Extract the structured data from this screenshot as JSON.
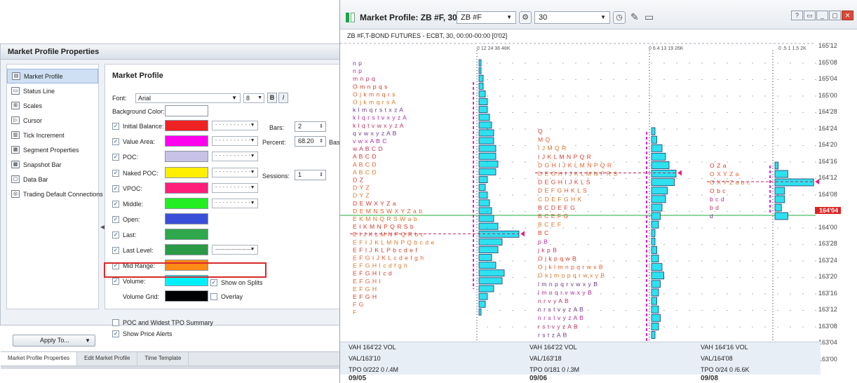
{
  "props": {
    "title": "Market Profile Properties",
    "sidebar": [
      {
        "label": "Market Profile",
        "icon": "market-profile-icon",
        "glyph": "▤"
      },
      {
        "label": "Status Line",
        "icon": "status-line-icon",
        "glyph": "▭"
      },
      {
        "label": "Scales",
        "icon": "scales-icon",
        "glyph": "⊞"
      },
      {
        "label": "Cursor",
        "icon": "cursor-icon",
        "glyph": "▷"
      },
      {
        "label": "Tick Increment",
        "icon": "tick-increment-icon",
        "glyph": "▥"
      },
      {
        "label": "Segment Properties",
        "icon": "segment-properties-icon",
        "glyph": "▦"
      },
      {
        "label": "Snapshot Bar",
        "icon": "snapshot-bar-icon",
        "glyph": "▩"
      },
      {
        "label": "Data Bar",
        "icon": "data-bar-icon",
        "glyph": "▢"
      },
      {
        "label": "Trading Default Connections",
        "icon": "connections-icon",
        "glyph": "◎"
      }
    ],
    "apply_label": "Apply To...",
    "heading": "Market Profile",
    "font_label": "Font:",
    "font_value": "Arial",
    "font_size": "8",
    "bold_label": "B",
    "italic_label": "I",
    "bg_label": "Background Color:",
    "rows": [
      {
        "label": "Initial Balance:",
        "color": "#ee2222",
        "line": "- - - - - - - - - -"
      },
      {
        "label": "Value Area:",
        "color": "#ff00ee",
        "line": "- - - - - - - - - -"
      },
      {
        "label": "POC:",
        "color": "#c8c2e6",
        "line": "- - - - - - - - - -"
      },
      {
        "label": "Naked POC:",
        "color": "#ffee00",
        "line": "- - - - - - - - - -"
      },
      {
        "label": "VPOC:",
        "color": "#ff1f7a",
        "line": "- - - - - - - - - -"
      },
      {
        "label": "Middle:",
        "color": "#22ee22",
        "line": "- - - - - - - - - -"
      },
      {
        "label": "Open:",
        "color": "#3a4fd8"
      },
      {
        "label": "Last:",
        "color": "#2ea84a"
      },
      {
        "label": "Last Level:",
        "color": "#2a9a45",
        "line": "———————"
      },
      {
        "label": "Mid Range:",
        "color": "#ff8a14"
      },
      {
        "label": "Volume:",
        "color": "#00f0ff"
      },
      {
        "label": "Volume Grid:",
        "color": "#000000"
      }
    ],
    "bars_label": "Bars:",
    "bars_value": "2",
    "percent_label": "Percent:",
    "percent_value": "68.20",
    "percent_suffix": "Bas",
    "sessions_label": "Sessions:",
    "sessions_value": "1",
    "show_on_splits": "Show on Splits",
    "overlay": "Overlay",
    "poc_widest": "POC and Widest TPO Summary",
    "price_alerts": "Show Price Alerts",
    "tabs": [
      "Market Profile Properties",
      "Edit Market Profile",
      "Time Template"
    ]
  },
  "chart": {
    "title": "Market Profile: ZB #F, 30",
    "symbol": "ZB #F",
    "interval": "30",
    "info_line": "ZB #F,T-BOND FUTURES - ECBT, 30, 00:00-00:00  [0'02]",
    "window_buttons": [
      "?",
      "▭",
      "_",
      "▢",
      "✕"
    ],
    "volume_scales": [
      {
        "label": "0  12  24  36  48K"
      },
      {
        "label": "0  6.4  13  19  26K"
      },
      {
        "label": "0  .5  1  1.5  2K"
      }
    ],
    "price_axis": [
      "165'12",
      "165'08",
      "165'04",
      "165'00",
      "164'28",
      "164'24",
      "164'20",
      "164'16",
      "164'12",
      "164'08",
      "164'04",
      "164'00",
      "163'28",
      "163'24",
      "163'20",
      "163'16",
      "163'12",
      "163'08",
      "163'04",
      "163'00"
    ],
    "current_price": "164'04",
    "summaries": [
      {
        "vah": "VAH 164'22  VOL",
        "val": "VAL/163'10",
        "tpo": "TPO 0/222  0 /.4M",
        "date": "09/05"
      },
      {
        "vah": "VAH 164'22  VOL",
        "val": "VAL/163'18",
        "tpo": "TPO 0/181    0 /.3M",
        "date": "09/06"
      },
      {
        "vah": "VAH 164'16  VOL",
        "val": "VAL/164'08",
        "tpo": "TPO 0/24    0 /6.6K",
        "date": "09/08"
      }
    ],
    "profiles": [
      {
        "rows": [
          "n p",
          "n p",
          "m n p q",
          "O m n p q s",
          "O j k m n q r s",
          "O j k m q r s A",
          "k l m q r s t x z A",
          "k l q r s t v x y z A",
          "k l q t v w x y z A",
          "q v w x y z A B",
          "v w x A B C",
          "w A B C D",
          "A B C D",
          "A B C D",
          "A B C D",
          "D Z",
          "D Y Z",
          "D Y Z",
          "D E W X Y Z a",
          "D E M N S W X Y Z a b",
          "E K M N Q R S W a b",
          "E I K M N P Q R S b",
          "E I J K L M N P Q R b c",
          "E F I J K L M N P Q b c d e",
          "E F I J K L P b c d e f",
          "E F G I J K L c d e f g h",
          "E F G H I c d f g h",
          "E F G H I c d",
          "E F G H I",
          "E F G H",
          "E F G H",
          "F G",
          "F"
        ],
        "volumes": [
          1,
          1,
          2,
          2,
          3,
          4,
          4,
          5,
          6,
          7,
          7,
          8,
          8,
          9,
          8,
          4,
          3,
          4,
          5,
          6,
          7,
          9,
          19,
          11,
          9,
          6,
          8,
          12,
          11,
          7,
          4,
          3,
          1
        ]
      },
      {
        "rows": [
          "Q",
          "M Q",
          "I J M Q R",
          "I J K L M N P Q R",
          "D G H I J K L M N P Q R",
          "D E G H I J K L M N P R S",
          "D E G H I J K L S",
          "D E F G H K L S",
          "C D E F G H K",
          "B C D E F G",
          "B C E F G",
          "B C E F",
          "B C",
          "p B",
          "j k p B",
          "O j k p q w B",
          "O j k l m n p q r w x B",
          "O k l m n p q r w x y B",
          "l m n p q r v w x y B",
          "l m n q r v w x y B",
          "n r v y A B",
          "n r s t v y z A B",
          "n r s t v y z A B",
          "r s t v y z A B",
          "r s t z A B"
        ],
        "volumes": [
          2,
          3,
          6,
          8,
          10,
          14,
          13,
          9,
          8,
          6,
          5,
          4,
          2,
          2,
          3,
          4,
          6,
          7,
          5,
          4,
          3,
          4,
          5,
          4,
          2
        ]
      },
      {
        "rows": [
          "O Z a",
          "O X Y Z a",
          "O X Y Z a b c",
          "O b c",
          "b c d",
          "b d",
          "d"
        ],
        "volumes": [
          1,
          4,
          12,
          3,
          3,
          2,
          4
        ]
      }
    ]
  }
}
